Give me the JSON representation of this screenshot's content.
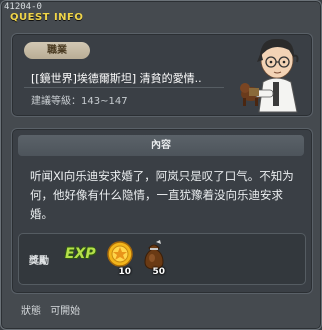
{
  "window": {
    "quest_id": "41204-0",
    "title": "QUEST INFO"
  },
  "info": {
    "job_label": "職業",
    "quest_name": "[[鏡世界]埃德爾斯坦] 清貧的愛情..",
    "level_req": "建議等級：143~147"
  },
  "content": {
    "header": "內容",
    "text": "听闻Ⅺ向乐迪安求婚了，阿岚只是叹了口气。不知为何，他好像有什么隐情，一直犹豫着没向乐迪安求婚。"
  },
  "rewards": {
    "label": "獎勵",
    "exp_icon": "EXP",
    "items": [
      {
        "icon": "gold-medal-icon",
        "qty": "10"
      },
      {
        "icon": "sack-icon",
        "qty": "50"
      }
    ]
  },
  "status": {
    "label": "狀態",
    "value": "可開始"
  },
  "colors": {
    "title": "#f0d54a",
    "exp": "#b5e04a"
  }
}
